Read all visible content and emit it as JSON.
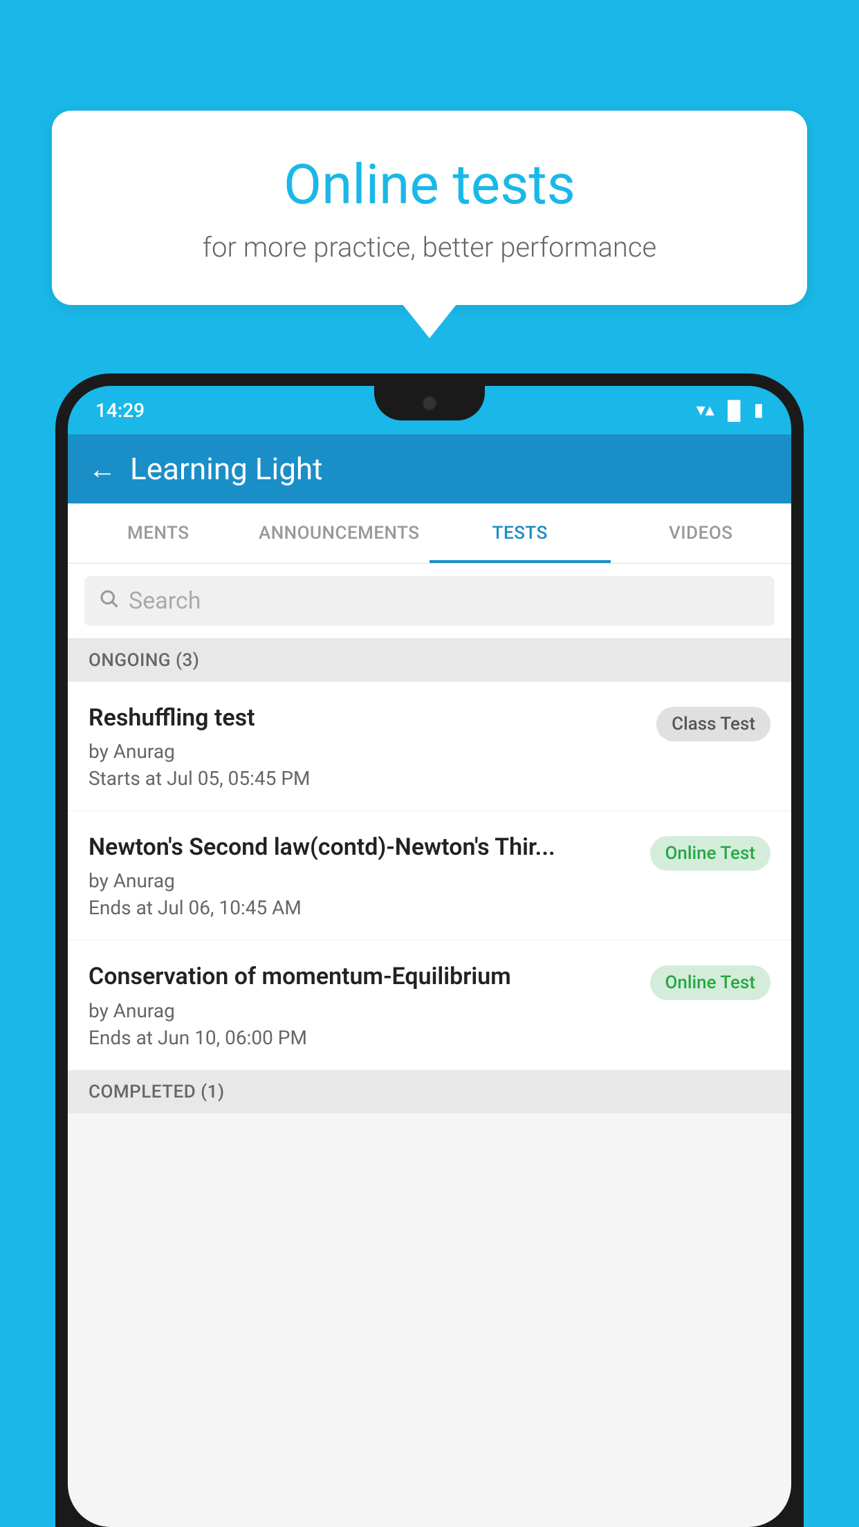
{
  "background_color": "#1ab8e8",
  "speech_bubble": {
    "title": "Online tests",
    "subtitle": "for more practice, better performance"
  },
  "phone": {
    "status_bar": {
      "time": "14:29",
      "wifi": "▼",
      "signal": "▲",
      "battery": "▮"
    },
    "app_header": {
      "title": "Learning Light",
      "back_label": "←"
    },
    "tabs": [
      {
        "id": "ments",
        "label": "MENTS",
        "active": false
      },
      {
        "id": "announcements",
        "label": "ANNOUNCEMENTS",
        "active": false
      },
      {
        "id": "tests",
        "label": "TESTS",
        "active": true
      },
      {
        "id": "videos",
        "label": "VIDEOS",
        "active": false
      }
    ],
    "search": {
      "placeholder": "Search"
    },
    "ongoing_section": {
      "header": "ONGOING (3)",
      "items": [
        {
          "name": "Reshuffling test",
          "by": "by Anurag",
          "date": "Starts at  Jul 05, 05:45 PM",
          "badge": "Class Test",
          "badge_type": "class"
        },
        {
          "name": "Newton's Second law(contd)-Newton's Thir...",
          "by": "by Anurag",
          "date": "Ends at  Jul 06, 10:45 AM",
          "badge": "Online Test",
          "badge_type": "online"
        },
        {
          "name": "Conservation of momentum-Equilibrium",
          "by": "by Anurag",
          "date": "Ends at  Jun 10, 06:00 PM",
          "badge": "Online Test",
          "badge_type": "online"
        }
      ]
    },
    "completed_section": {
      "header": "COMPLETED (1)"
    }
  }
}
